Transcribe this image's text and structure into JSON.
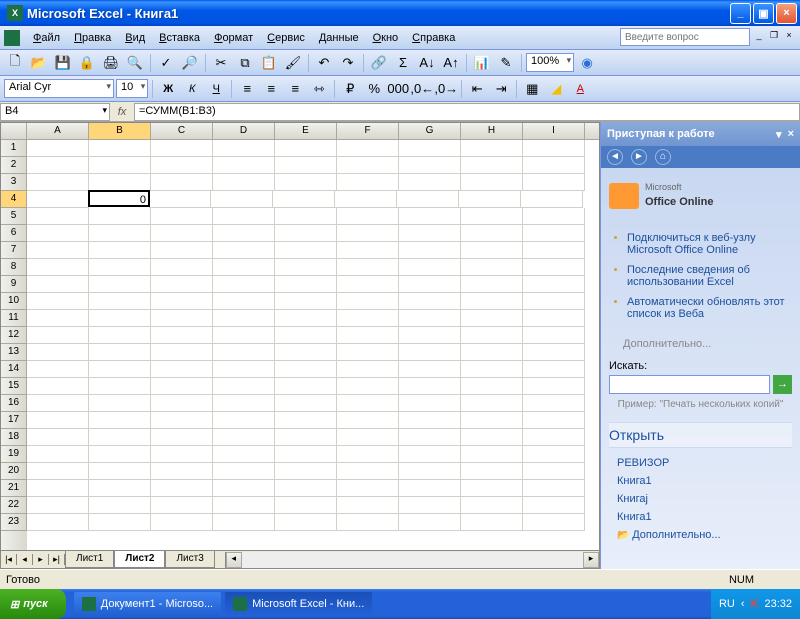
{
  "titlebar": {
    "title": "Microsoft Excel - Книга1"
  },
  "menu": {
    "items": [
      "Файл",
      "Правка",
      "Вид",
      "Вставка",
      "Формат",
      "Сервис",
      "Данные",
      "Окно",
      "Справка"
    ],
    "help_placeholder": "Введите вопрос"
  },
  "toolbar2": {
    "font": "Arial Cyr",
    "size": "10"
  },
  "toolbar1": {
    "zoom": "100%"
  },
  "formulabar": {
    "cell_ref": "B4",
    "formula": "=СУММ(B1:B3)"
  },
  "sheet": {
    "columns": [
      "A",
      "B",
      "C",
      "D",
      "E",
      "F",
      "G",
      "H",
      "I"
    ],
    "row_count": 23,
    "active_cell": {
      "row": 4,
      "col": "B",
      "value": "0"
    },
    "tabs": [
      "Лист1",
      "Лист2",
      "Лист3"
    ],
    "active_tab": 1
  },
  "taskpane": {
    "title": "Приступая к работе",
    "office_online": "Office Online",
    "office_prefix": "Microsoft",
    "links": [
      "Подключиться к веб-узлу Microsoft Office Online",
      "Последние сведения об использовании Excel",
      "Автоматически обновлять этот список из Веба"
    ],
    "more": "Дополнительно...",
    "search_label": "Искать:",
    "example": "Пример: \"Печать нескольких копий\"",
    "open_header": "Открыть",
    "recent": [
      "РЕВИЗОР",
      "Книга1",
      "Книгај",
      "Книга1"
    ],
    "open_more": "Дополнительно..."
  },
  "statusbar": {
    "status": "Готово",
    "num": "NUM"
  },
  "taskbar": {
    "start": "пуск",
    "items": [
      "Документ1 - Microso...",
      "Microsoft Excel - Кни..."
    ],
    "lang": "RU",
    "time": "23:32"
  }
}
